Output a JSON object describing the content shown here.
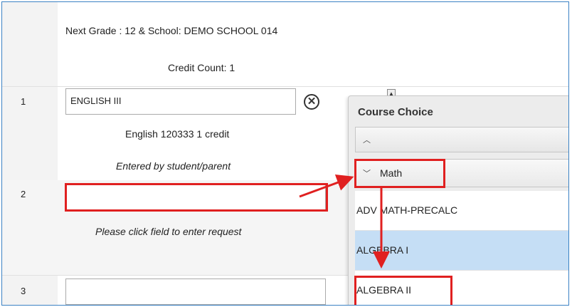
{
  "header": {
    "next_grade": "Next Grade : 12 & School: DEMO SCHOOL 014",
    "credit_count": "Credit Count: 1"
  },
  "rows": [
    {
      "number": "1",
      "field_value": "ENGLISH III",
      "course_info": "English 120333 1 credit",
      "entered_by": "Entered by student/parent"
    },
    {
      "number": "2",
      "field_value": "",
      "hint": "Please click field to enter request"
    },
    {
      "number": "3",
      "field_value": ""
    }
  ],
  "course_choice": {
    "title": "Course Choice",
    "group_label": "Math",
    "items": [
      {
        "label": "ADV MATH-PRECALC",
        "selected": false
      },
      {
        "label": "ALGEBRA I",
        "selected": true
      },
      {
        "label": "ALGEBRA II",
        "selected": false
      }
    ]
  },
  "colors": {
    "annotation_red": "#e02020",
    "selected_item_bg": "#c5def5",
    "frame_border": "#3b82c4"
  }
}
